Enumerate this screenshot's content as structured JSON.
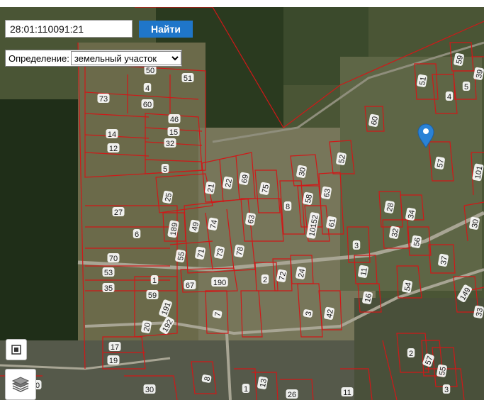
{
  "search": {
    "value": "28:01:110091:21",
    "button_label": "Найти"
  },
  "definition": {
    "label": "Определение:",
    "selected": "земельный участок"
  },
  "map": {
    "marker_icon": "map-pin-icon",
    "parcel_labels": [
      "50",
      "51",
      "4",
      "73",
      "60",
      "46",
      "15",
      "14",
      "32",
      "12",
      "5",
      "25",
      "27",
      "6",
      "70",
      "53",
      "35",
      "1",
      "59",
      "191",
      "20",
      "192",
      "17",
      "19",
      "30",
      "189",
      "49",
      "74",
      "55",
      "71",
      "73",
      "78",
      "21",
      "22",
      "69",
      "75",
      "63",
      "8",
      "30",
      "58",
      "63",
      "10152",
      "61",
      "67",
      "190",
      "2",
      "72",
      "24",
      "3",
      "42",
      "52",
      "60",
      "51",
      "4",
      "5",
      "59",
      "39",
      "57",
      "101",
      "28",
      "34",
      "32",
      "56",
      "3",
      "11",
      "16",
      "37",
      "54",
      "30",
      "149",
      "33",
      "2",
      "57",
      "55",
      "3",
      "8",
      "13",
      "26",
      "1",
      "11",
      "7",
      "30"
    ],
    "layer_control_icon": "layers-icon",
    "fullscreen_control_icon": "fullscreen-icon"
  },
  "colors": {
    "parcel_border": "#d01818",
    "label_bg": "#ffffff",
    "marker": "#2a82d6",
    "button_bg": "#1f76c9"
  }
}
